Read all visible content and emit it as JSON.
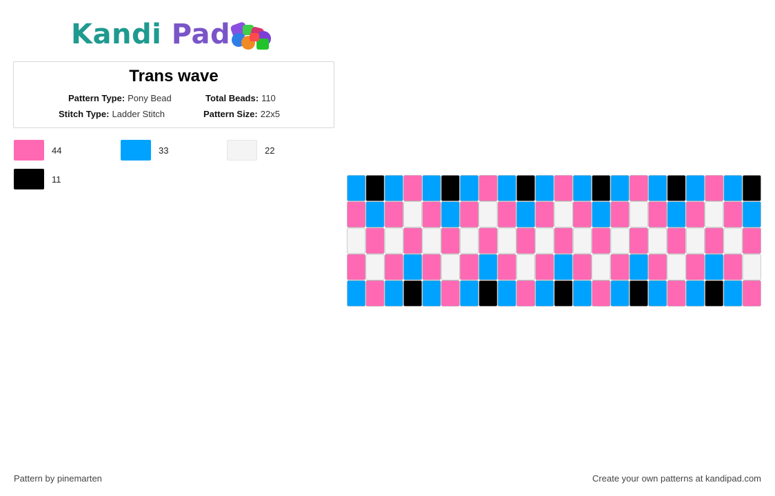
{
  "logo": {
    "text_part1": "Kandi",
    "text_part2": "Pad",
    "icon": "bead-pile-icon"
  },
  "pattern_info": {
    "title": "Trans wave",
    "pattern_type_label": "Pattern Type:",
    "pattern_type_value": "Pony Bead",
    "total_beads_label": "Total Beads:",
    "total_beads_value": "110",
    "stitch_type_label": "Stitch Type:",
    "stitch_type_value": "Ladder Stitch",
    "pattern_size_label": "Pattern Size:",
    "pattern_size_value": "22x5"
  },
  "legend": [
    {
      "color": "#ff69b4",
      "count": "44"
    },
    {
      "color": "#00a2ff",
      "count": "33"
    },
    {
      "color": "#f4f4f4",
      "count": "22"
    },
    {
      "color": "#000000",
      "count": "11"
    }
  ],
  "bead_grid": {
    "columns": 22,
    "rows": 5,
    "palette": {
      "P": "#ff69b4",
      "B": "#00a2ff",
      "W": "#f4f4f4",
      "K": "#000000"
    },
    "cells": [
      "BKBPBKBPBKBPBKBPBKBPBK",
      "PBPWPBPWPBPWPBPWPBPWPB",
      "WPWPWPWPWPWPWPWPWPWPWP",
      "PWPBPWPBPWPBPWPBPWPBPW",
      "BPBKBPBKBPBKBPBKBPBKBP"
    ]
  },
  "footer": {
    "author": "Pattern by pinemarten",
    "promo": "Create your own patterns at kandipad.com"
  }
}
